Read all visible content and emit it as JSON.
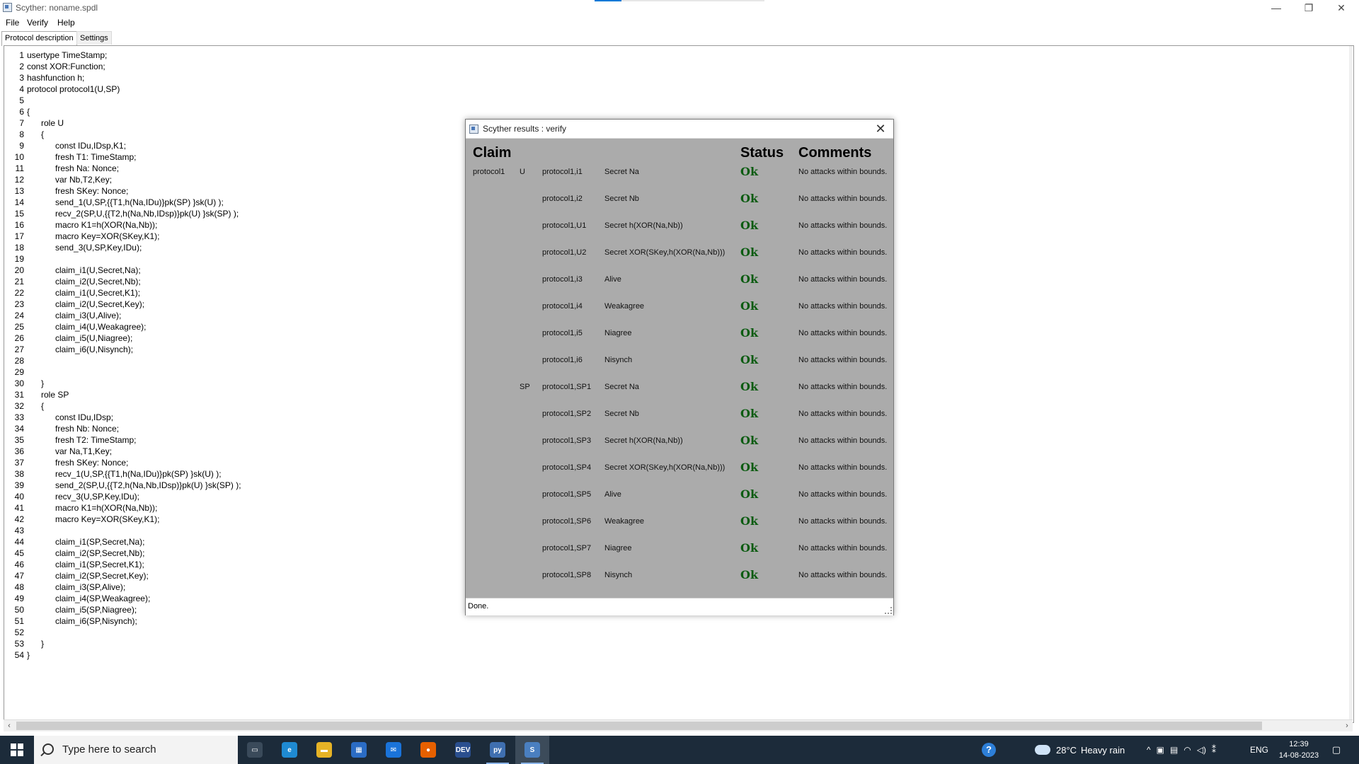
{
  "window": {
    "title": "Scyther: noname.spdl",
    "controls": {
      "minimize": "—",
      "maximize": "❐",
      "close": "✕"
    },
    "load_progress": 0.16
  },
  "menu": [
    "File",
    "Verify",
    "Help"
  ],
  "tabs": [
    {
      "label": "Protocol description",
      "active": true
    },
    {
      "label": "Settings",
      "active": false
    }
  ],
  "code": [
    {
      "n": "1",
      "text": "usertype TimeStamp;"
    },
    {
      "n": "2",
      "text": "const XOR:Function;"
    },
    {
      "n": "3",
      "text": "hashfunction h;"
    },
    {
      "n": "4",
      "text": "protocol protocol1(U,SP)"
    },
    {
      "n": "5",
      "text": ""
    },
    {
      "n": "6",
      "text": "{"
    },
    {
      "n": "7",
      "text": "      role U"
    },
    {
      "n": "8",
      "text": "      {"
    },
    {
      "n": "9",
      "text": "            const IDu,IDsp,K1;"
    },
    {
      "n": "10",
      "text": "            fresh T1: TimeStamp;"
    },
    {
      "n": "11",
      "text": "            fresh Na: Nonce;"
    },
    {
      "n": "12",
      "text": "            var Nb,T2,Key;"
    },
    {
      "n": "13",
      "text": "            fresh SKey: Nonce;"
    },
    {
      "n": "14",
      "text": "            send_1(U,SP,{{T1,h(Na,IDu)}pk(SP) }sk(U) );"
    },
    {
      "n": "15",
      "text": "            recv_2(SP,U,{{T2,h(Na,Nb,IDsp)}pk(U) }sk(SP) );"
    },
    {
      "n": "16",
      "text": "            macro K1=h(XOR(Na,Nb));"
    },
    {
      "n": "17",
      "text": "            macro Key=XOR(SKey,K1);"
    },
    {
      "n": "18",
      "text": "            send_3(U,SP,Key,IDu);"
    },
    {
      "n": "19",
      "text": ""
    },
    {
      "n": "20",
      "text": "            claim_i1(U,Secret,Na);"
    },
    {
      "n": "21",
      "text": "            claim_i2(U,Secret,Nb);"
    },
    {
      "n": "22",
      "text": "            claim_i1(U,Secret,K1);"
    },
    {
      "n": "23",
      "text": "            claim_i2(U,Secret,Key);"
    },
    {
      "n": "24",
      "text": "            claim_i3(U,Alive);"
    },
    {
      "n": "25",
      "text": "            claim_i4(U,Weakagree);"
    },
    {
      "n": "26",
      "text": "            claim_i5(U,Niagree);"
    },
    {
      "n": "27",
      "text": "            claim_i6(U,Nisynch);"
    },
    {
      "n": "28",
      "text": ""
    },
    {
      "n": "29",
      "text": ""
    },
    {
      "n": "30",
      "text": "      }"
    },
    {
      "n": "31",
      "text": "      role SP"
    },
    {
      "n": "32",
      "text": "      {"
    },
    {
      "n": "33",
      "text": "            const IDu,IDsp;"
    },
    {
      "n": "34",
      "text": "            fresh Nb: Nonce;"
    },
    {
      "n": "35",
      "text": "            fresh T2: TimeStamp;"
    },
    {
      "n": "36",
      "text": "            var Na,T1,Key;"
    },
    {
      "n": "37",
      "text": "            fresh SKey: Nonce;"
    },
    {
      "n": "38",
      "text": "            recv_1(U,SP,{{T1,h(Na,IDu)}pk(SP) }sk(U) );"
    },
    {
      "n": "39",
      "text": "            send_2(SP,U,{{T2,h(Na,Nb,IDsp)}pk(U) }sk(SP) );"
    },
    {
      "n": "40",
      "text": "            recv_3(U,SP,Key,IDu);"
    },
    {
      "n": "41",
      "text": "            macro K1=h(XOR(Na,Nb));"
    },
    {
      "n": "42",
      "text": "            macro Key=XOR(SKey,K1);"
    },
    {
      "n": "43",
      "text": ""
    },
    {
      "n": "44",
      "text": "            claim_i1(SP,Secret,Na);"
    },
    {
      "n": "45",
      "text": "            claim_i2(SP,Secret,Nb);"
    },
    {
      "n": "46",
      "text": "            claim_i1(SP,Secret,K1);"
    },
    {
      "n": "47",
      "text": "            claim_i2(SP,Secret,Key);"
    },
    {
      "n": "48",
      "text": "            claim_i3(SP,Alive);"
    },
    {
      "n": "49",
      "text": "            claim_i4(SP,Weakagree);"
    },
    {
      "n": "50",
      "text": "            claim_i5(SP,Niagree);"
    },
    {
      "n": "51",
      "text": "            claim_i6(SP,Nisynch);"
    },
    {
      "n": "52",
      "text": ""
    },
    {
      "n": "53",
      "text": "      }"
    },
    {
      "n": "54",
      "text": "}"
    }
  ],
  "results": {
    "title": "Scyther results : verify",
    "close": "✕",
    "headers": {
      "claim": "Claim",
      "status": "Status",
      "comments": "Comments"
    },
    "rows": [
      {
        "protocol": "protocol1",
        "role": "U",
        "id": "protocol1,i1",
        "claim": "Secret Na",
        "status": "Ok",
        "comment": "No attacks within bounds."
      },
      {
        "protocol": "",
        "role": "",
        "id": "protocol1,i2",
        "claim": "Secret Nb",
        "status": "Ok",
        "comment": "No attacks within bounds."
      },
      {
        "protocol": "",
        "role": "",
        "id": "protocol1,U1",
        "claim": "Secret h(XOR(Na,Nb))",
        "status": "Ok",
        "comment": "No attacks within bounds."
      },
      {
        "protocol": "",
        "role": "",
        "id": "protocol1,U2",
        "claim": "Secret XOR(SKey,h(XOR(Na,Nb)))",
        "status": "Ok",
        "comment": "No attacks within bounds."
      },
      {
        "protocol": "",
        "role": "",
        "id": "protocol1,i3",
        "claim": "Alive",
        "status": "Ok",
        "comment": "No attacks within bounds."
      },
      {
        "protocol": "",
        "role": "",
        "id": "protocol1,i4",
        "claim": "Weakagree",
        "status": "Ok",
        "comment": "No attacks within bounds."
      },
      {
        "protocol": "",
        "role": "",
        "id": "protocol1,i5",
        "claim": "Niagree",
        "status": "Ok",
        "comment": "No attacks within bounds."
      },
      {
        "protocol": "",
        "role": "",
        "id": "protocol1,i6",
        "claim": "Nisynch",
        "status": "Ok",
        "comment": "No attacks within bounds."
      },
      {
        "protocol": "",
        "role": "SP",
        "id": "protocol1,SP1",
        "claim": "Secret Na",
        "status": "Ok",
        "comment": "No attacks within bounds."
      },
      {
        "protocol": "",
        "role": "",
        "id": "protocol1,SP2",
        "claim": "Secret Nb",
        "status": "Ok",
        "comment": "No attacks within bounds."
      },
      {
        "protocol": "",
        "role": "",
        "id": "protocol1,SP3",
        "claim": "Secret h(XOR(Na,Nb))",
        "status": "Ok",
        "comment": "No attacks within bounds."
      },
      {
        "protocol": "",
        "role": "",
        "id": "protocol1,SP4",
        "claim": "Secret XOR(SKey,h(XOR(Na,Nb)))",
        "status": "Ok",
        "comment": "No attacks within bounds."
      },
      {
        "protocol": "",
        "role": "",
        "id": "protocol1,SP5",
        "claim": "Alive",
        "status": "Ok",
        "comment": "No attacks within bounds."
      },
      {
        "protocol": "",
        "role": "",
        "id": "protocol1,SP6",
        "claim": "Weakagree",
        "status": "Ok",
        "comment": "No attacks within bounds."
      },
      {
        "protocol": "",
        "role": "",
        "id": "protocol1,SP7",
        "claim": "Niagree",
        "status": "Ok",
        "comment": "No attacks within bounds."
      },
      {
        "protocol": "",
        "role": "",
        "id": "protocol1,SP8",
        "claim": "Nisynch",
        "status": "Ok",
        "comment": "No attacks within bounds."
      }
    ],
    "status_text": "Done.",
    "ok_color": "#0a5b10"
  },
  "scrollbar": {
    "left_arrow": "‹",
    "right_arrow": "›"
  },
  "taskbar": {
    "search_placeholder": "Type here to search",
    "apps": [
      {
        "name": "task-view",
        "glyph": "▭"
      },
      {
        "name": "edge",
        "glyph": "e"
      },
      {
        "name": "file-explorer",
        "glyph": "▬"
      },
      {
        "name": "microsoft-store",
        "glyph": "▦"
      },
      {
        "name": "mail",
        "glyph": "✉"
      },
      {
        "name": "firefox",
        "glyph": "●"
      },
      {
        "name": "dev-cpp",
        "glyph": "DEV"
      },
      {
        "name": "python-idle",
        "glyph": "py"
      },
      {
        "name": "scyther",
        "glyph": "S"
      }
    ],
    "help_glyph": "?",
    "weather": {
      "temp": "28°C",
      "condition": "Heavy rain"
    },
    "tray_icons": [
      "^",
      "▣",
      "▤",
      "◠",
      "◁)",
      "⁑"
    ],
    "language": "ENG",
    "time": "12:39",
    "date": "14-08-2023",
    "notification_glyph": "▢"
  },
  "colors": {
    "taskbar": "#1c2b3a",
    "accent": "#0078d7",
    "results_bg": "#ababab"
  }
}
